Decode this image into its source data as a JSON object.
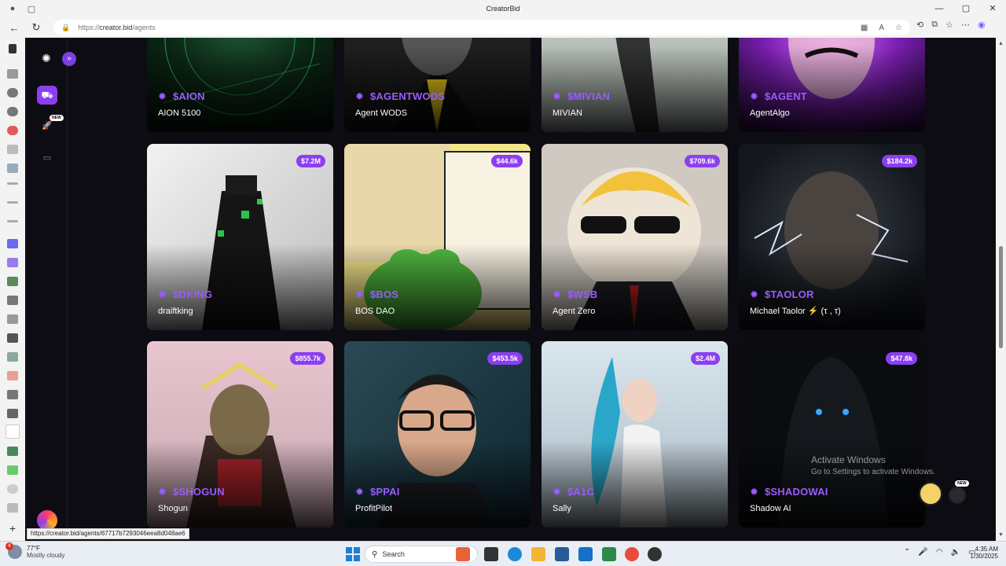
{
  "browser": {
    "window_title": "CreatorBid",
    "url_prefix": "https://",
    "url_domain": "creator.bid",
    "url_path": "/agents",
    "status_url": "https://creator.bid/agents/67717b7293046eea8d048ae6"
  },
  "sidebar": {
    "new_badge": "NEW"
  },
  "agents": [
    {
      "ticker": "$AION",
      "name": "AION 5100",
      "mcap": ""
    },
    {
      "ticker": "$AGENTWODS",
      "name": "Agent WODS",
      "mcap": ""
    },
    {
      "ticker": "$MIVIAN",
      "name": "MIVIAN",
      "mcap": ""
    },
    {
      "ticker": "$AGENT",
      "name": "AgentAlgo",
      "mcap": ""
    },
    {
      "ticker": "$DKING",
      "name": "draiftking",
      "mcap": "$7.2M"
    },
    {
      "ticker": "$BOS",
      "name": "BOS DAO",
      "mcap": "$44.6k"
    },
    {
      "ticker": "$WSB",
      "name": "Agent Zero",
      "mcap": "$709.6k"
    },
    {
      "ticker": "$TAOLOR",
      "name": "Michael Taolor ⚡ (τ , τ)",
      "mcap": "$184.2k"
    },
    {
      "ticker": "$SHOGUN",
      "name": "Shogun",
      "mcap": "$855.7k"
    },
    {
      "ticker": "$PPAI",
      "name": "ProfitPilot",
      "mcap": "$453.5k"
    },
    {
      "ticker": "$A1C",
      "name": "Sally",
      "mcap": "$2.4M"
    },
    {
      "ticker": "$SHADOWAI",
      "name": "Shadow AI",
      "mcap": "$47.8k"
    }
  ],
  "watermark": {
    "line1": "Activate Windows",
    "line2": "Go to Settings to activate Windows."
  },
  "floating_new": "NEW",
  "taskbar": {
    "weather_badge": "4",
    "temperature": "77°F",
    "condition": "Mostly cloudy",
    "search_placeholder": "Search",
    "time": "4:35 AM",
    "date": "1/30/2025"
  },
  "colors": {
    "accent": "#8b3ff0",
    "ticker": "#9a5bff",
    "background": "#0c0c12"
  }
}
